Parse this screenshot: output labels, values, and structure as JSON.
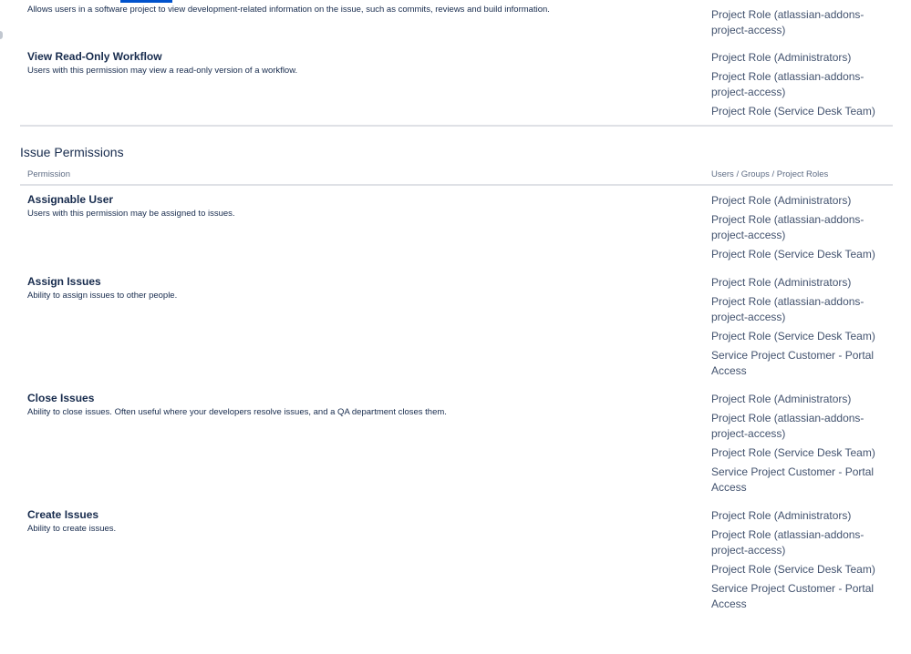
{
  "rows_top": [
    {
      "name": "",
      "description": "Allows users in a software project to view development-related information on the issue, such as commits, reviews and build information.",
      "roles": [
        "Project Role (atlassian-addons-project-access)"
      ]
    },
    {
      "name": "View Read-Only Workflow",
      "description": "Users with this permission may view a read-only version of a workflow.",
      "roles": [
        "Project Role (Administrators)",
        "Project Role (atlassian-addons-project-access)",
        "Project Role (Service Desk Team)"
      ]
    }
  ],
  "issue_section": {
    "title": "Issue Permissions",
    "header": {
      "permission": "Permission",
      "holders": "Users / Groups / Project Roles"
    },
    "rows": [
      {
        "name": "Assignable User",
        "description": "Users with this permission may be assigned to issues.",
        "roles": [
          "Project Role (Administrators)",
          "Project Role (atlassian-addons-project-access)",
          "Project Role (Service Desk Team)"
        ]
      },
      {
        "name": "Assign Issues",
        "description": "Ability to assign issues to other people.",
        "roles": [
          "Project Role (Administrators)",
          "Project Role (atlassian-addons-project-access)",
          "Project Role (Service Desk Team)",
          "Service Project Customer - Portal Access"
        ]
      },
      {
        "name": "Close Issues",
        "description": "Ability to close issues. Often useful where your developers resolve issues, and a QA department closes them.",
        "roles": [
          "Project Role (Administrators)",
          "Project Role (atlassian-addons-project-access)",
          "Project Role (Service Desk Team)",
          "Service Project Customer - Portal Access"
        ]
      },
      {
        "name": "Create Issues",
        "description": "Ability to create issues.",
        "roles": [
          "Project Role (Administrators)",
          "Project Role (atlassian-addons-project-access)",
          "Project Role (Service Desk Team)",
          "Service Project Customer - Portal Access"
        ]
      }
    ]
  },
  "colors": {
    "accent": "#0052cc",
    "text": "#172b4d",
    "role_text": "#42526e",
    "subtle": "#5e6c84",
    "divider": "#dfe1e6"
  }
}
